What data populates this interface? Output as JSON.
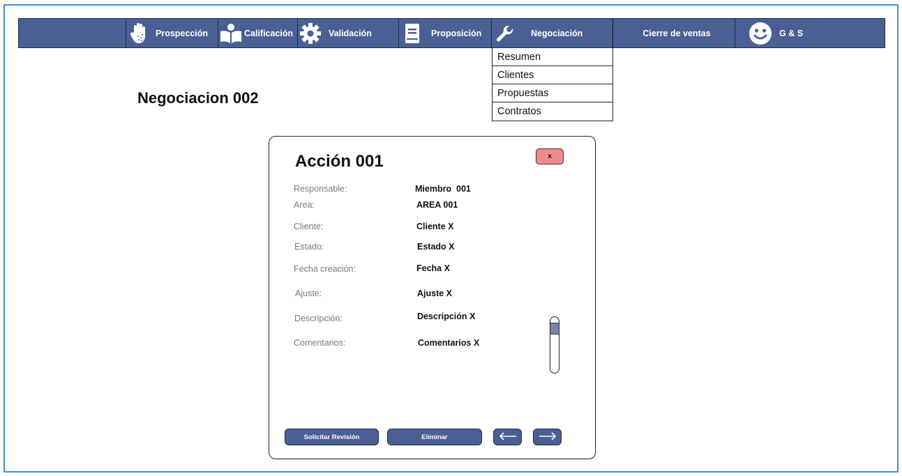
{
  "nav": {
    "items": [
      {
        "label": "Prospección",
        "icon": "hand-icon"
      },
      {
        "label": "Calificación",
        "icon": "reader-icon"
      },
      {
        "label": "Validación",
        "icon": "gear-icon"
      },
      {
        "label": "Proposición",
        "icon": "book-icon"
      },
      {
        "label": "Negociación",
        "icon": "wrench-icon"
      },
      {
        "label": "Cierre de ventas",
        "icon": ""
      },
      {
        "label": "G & S",
        "icon": "smiley-icon"
      }
    ]
  },
  "dropdown": {
    "items": [
      "Resumen",
      "Clientes",
      "Propuestas",
      "Contratos"
    ]
  },
  "page": {
    "title": "Negociacion 002"
  },
  "modal": {
    "title": "Acción 001",
    "close_label": "x",
    "fields": [
      {
        "label": "Responsable:",
        "value": "Miembro  001"
      },
      {
        "label": "Area:",
        "value": "AREA 001"
      },
      {
        "label": "Cliente:",
        "value": "Cliente X"
      },
      {
        "label": "Estado:",
        "value": "Estado X"
      },
      {
        "label": "Fecha creación:",
        "value": "Fecha X"
      },
      {
        "label": "Ajuste:",
        "value": "Ajuste X"
      },
      {
        "label": "Descripción:",
        "value": "Descripción X"
      },
      {
        "label": "Comentarios:",
        "value": "Comentarios X"
      }
    ],
    "buttons": {
      "review": "Solicitar Revisión",
      "delete": "Eliminar"
    }
  },
  "colors": {
    "nav_bg": "#4a5f94",
    "frame": "#3b8fd6",
    "close_bg": "#f08a8f",
    "scroll_thumb": "#7a82a8"
  }
}
